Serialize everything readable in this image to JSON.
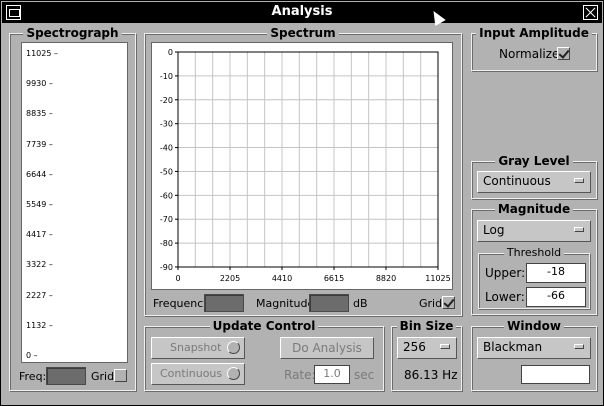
{
  "window": {
    "title": "Analysis"
  },
  "spectrograph": {
    "title": "Spectrograph",
    "freq_label": "Freq:",
    "grid_label": "Grid",
    "y_ticks": [
      "11025 –",
      "9930 –",
      "8835 –",
      "7739 –",
      "6644 –",
      "5549 –",
      "4417 –",
      "3322 –",
      "2227 –",
      "1132 –",
      "0 –"
    ]
  },
  "spectrum": {
    "title": "Spectrum",
    "frequency_label": "Frequency:",
    "magnitude_label": "Magnitude:",
    "db_unit": "dB",
    "grid_label": "Grid",
    "grid_checked": true
  },
  "chart_data": {
    "type": "line",
    "x_ticks": [
      "0",
      "2205",
      "4410",
      "6615",
      "8820",
      "11025"
    ],
    "y_ticks": [
      "0",
      "-10",
      "-20",
      "-30",
      "-40",
      "-50",
      "-60",
      "-70",
      "-80",
      "-90"
    ],
    "xlim": [
      0,
      11025
    ],
    "ylim": [
      -90,
      0
    ],
    "grid": true,
    "series": []
  },
  "input_amplitude": {
    "title": "Input Amplitude",
    "normalize_label": "Normalize",
    "normalize_checked": true
  },
  "gray_level": {
    "title": "Gray Level",
    "selected": "Continuous"
  },
  "magnitude": {
    "title": "Magnitude",
    "selected": "Log",
    "threshold": {
      "title": "Threshold",
      "upper_label": "Upper:",
      "upper_value": "-18",
      "lower_label": "Lower:",
      "lower_value": "-66"
    }
  },
  "update_control": {
    "title": "Update Control",
    "snapshot_label": "Snapshot",
    "continuous_label": "Continuous",
    "do_analysis_label": "Do Analysis",
    "rate_label": "Rate:",
    "rate_value": "1.0",
    "rate_unit": "sec"
  },
  "bin_size": {
    "title": "Bin Size",
    "selected": "256",
    "resolution": "86.13 Hz"
  },
  "window_fn": {
    "title": "Window",
    "selected": "Blackman",
    "entry_value": ""
  }
}
